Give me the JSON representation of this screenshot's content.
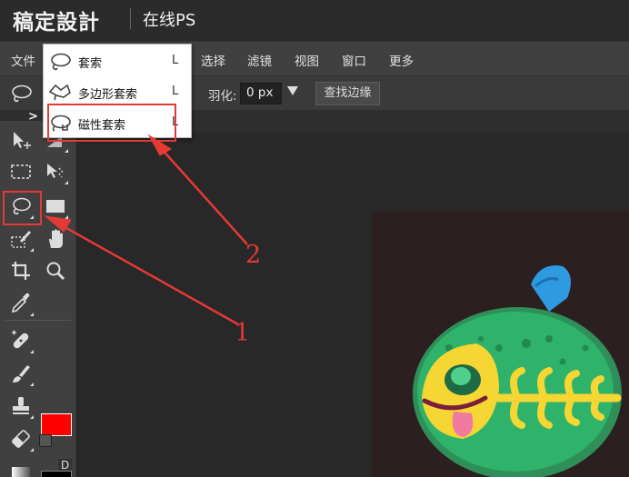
{
  "app": {
    "brand": "稿定設計",
    "subtitle": "在线PS"
  },
  "menu": [
    "文件",
    "选择",
    "滤镜",
    "视图",
    "窗口",
    "更多"
  ],
  "options": {
    "feather_label": "羽化:",
    "feather_value": "0 px",
    "find_edge_button": "查找边缘"
  },
  "tabstrip": {
    "collapse": ">"
  },
  "dropdown": {
    "items": [
      {
        "label": "套索",
        "shortcut": "L"
      },
      {
        "label": "多边形套索",
        "shortcut": "L"
      },
      {
        "label": "磁性套索",
        "shortcut": "L"
      }
    ]
  },
  "toolbar": {
    "bg_default_label": "D",
    "foreground_color": "#ff0000",
    "background_color": "#000000"
  },
  "annotations": {
    "one": "1",
    "two": "2"
  },
  "colors": {
    "accent_red": "#e53935",
    "fish_green": "#2fb36a",
    "fish_yellow": "#f5d632",
    "fin_blue": "#2e9ae0"
  }
}
